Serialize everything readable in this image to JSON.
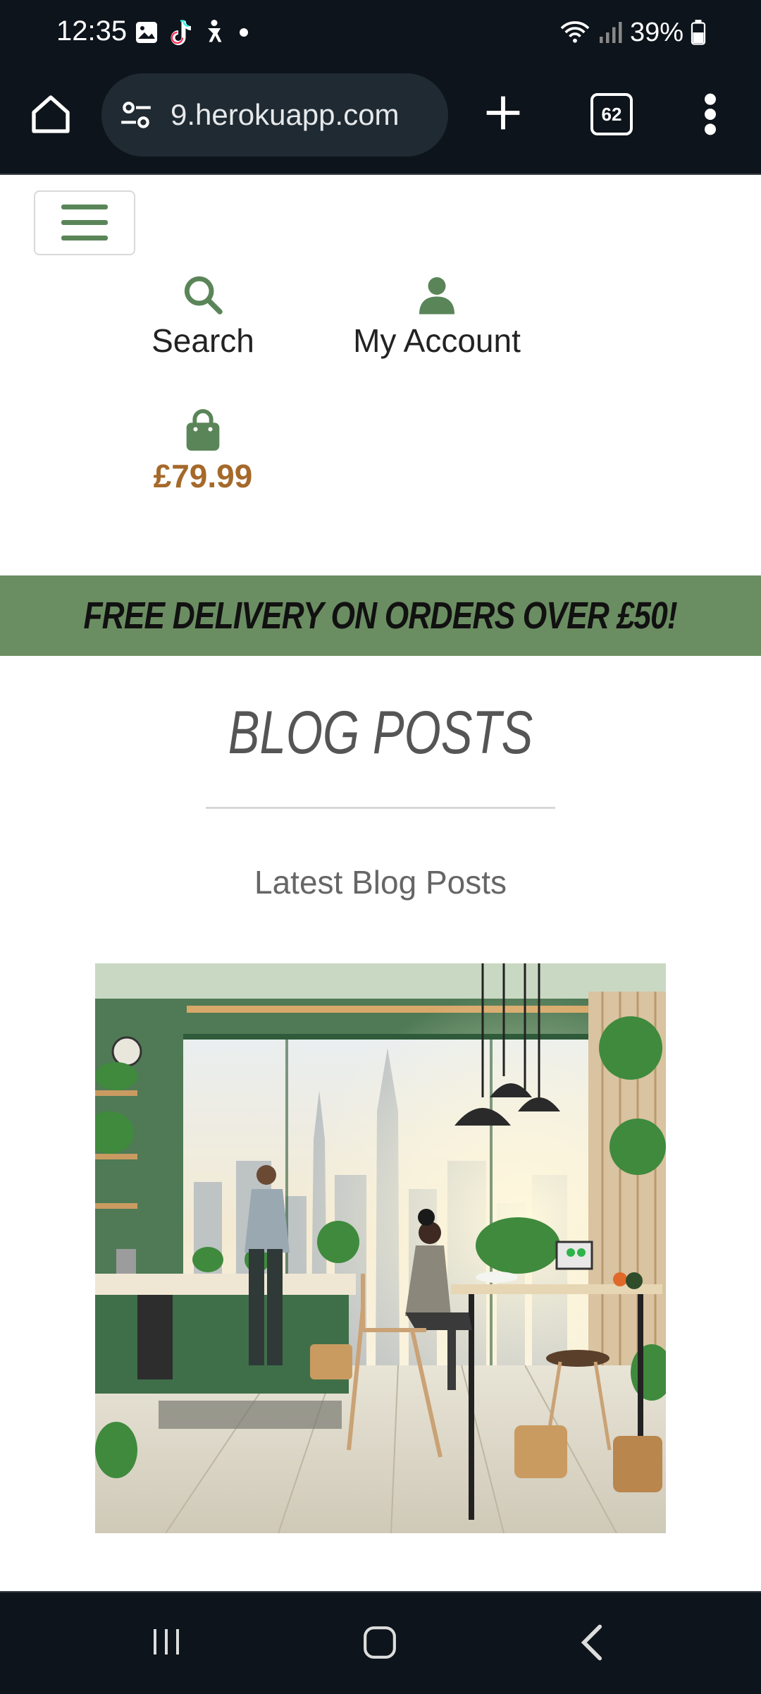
{
  "status_bar": {
    "time": "12:35",
    "battery": "39%",
    "icons": [
      "gallery-icon",
      "tiktok-icon",
      "accessibility-icon",
      "dot-icon",
      "wifi-icon",
      "signal-icon",
      "battery-icon"
    ]
  },
  "browser": {
    "url": "9.herokuapp.com",
    "tab_count": "62"
  },
  "site_nav": {
    "search_label": "Search",
    "account_label": "My Account",
    "cart_total": "£79.99"
  },
  "banner": {
    "text": "FREE DELIVERY ON ORDERS OVER £50!"
  },
  "page": {
    "title": "BLOG POSTS",
    "subtitle": "Latest Blog Posts"
  },
  "colors": {
    "brand_green": "#6b8d62",
    "price_brown": "#a5692a",
    "chrome_dark": "#0d141b"
  }
}
